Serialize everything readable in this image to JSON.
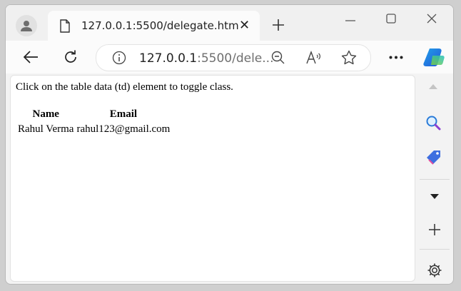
{
  "tab": {
    "title": "127.0.0.1:5500/delegate.htm"
  },
  "address": {
    "host": "127.0.0.1",
    "rest": ":5500/dele..."
  },
  "page": {
    "intro": "Click on the table data (td) element to toggle class.",
    "table": {
      "headers": [
        "Name",
        "Email"
      ],
      "rows": [
        [
          "Rahul Verma",
          "rahul123@gmail.com"
        ]
      ]
    }
  },
  "icons": {
    "profile": "profile-icon",
    "favicon": "document-icon",
    "close": "close-icon",
    "newtab": "plus-icon",
    "back": "back-arrow-icon",
    "refresh": "refresh-icon",
    "info": "info-icon",
    "zoom": "zoom-out-icon",
    "read-aloud": "read-aloud-icon",
    "favorite": "star-icon",
    "more": "more-icon",
    "copilot": "copilot-icon",
    "search": "search-icon",
    "shopping": "tag-icon",
    "settings": "gear-icon"
  },
  "colors": {
    "accent": "#2a7bd8",
    "copilot": "#1fa0e8"
  }
}
